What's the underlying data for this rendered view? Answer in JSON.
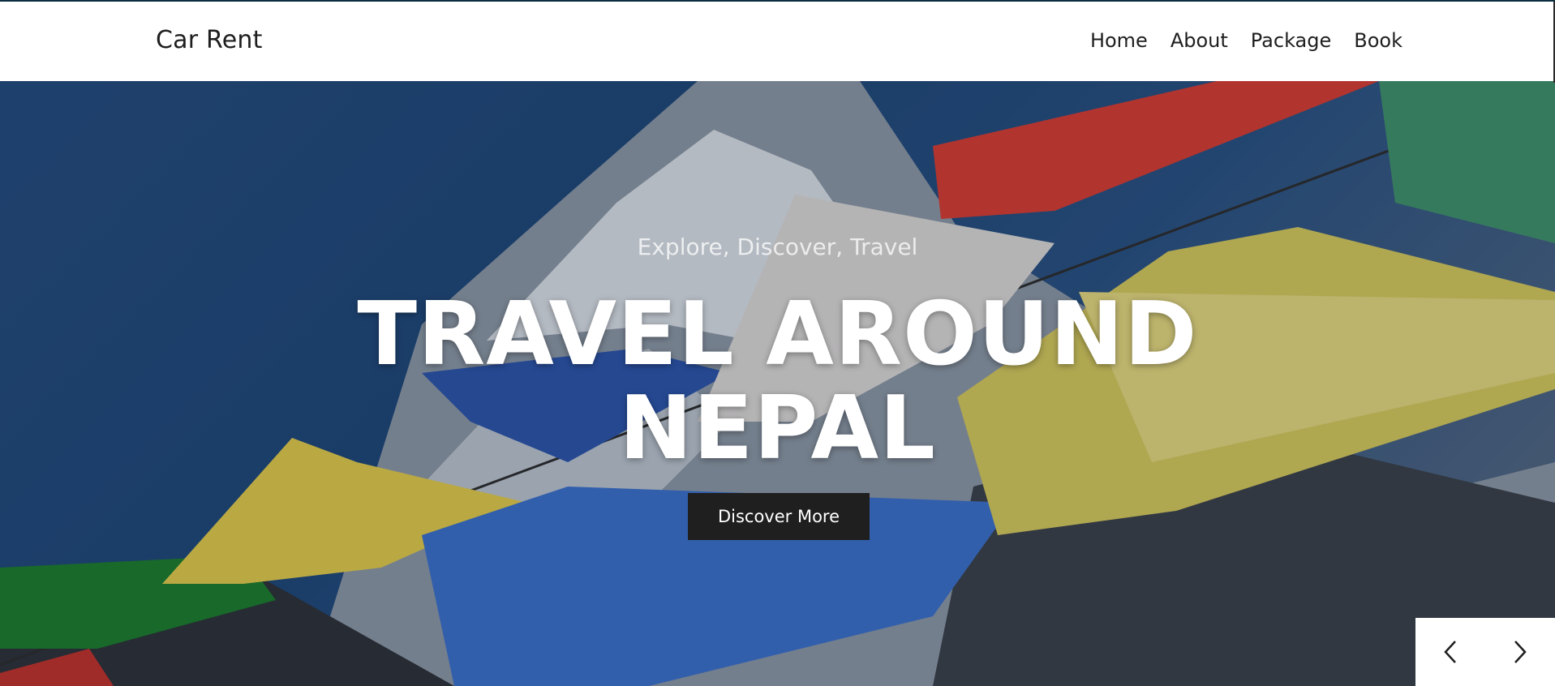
{
  "nav": {
    "brand": "Car Rent",
    "links": [
      "Home",
      "About",
      "Package",
      "Book"
    ]
  },
  "hero": {
    "subtitle": "Explore, Discover, Travel",
    "title_line1": "TRAVEL AROUND",
    "title_line2": "NEPAL",
    "cta_label": "Discover More"
  },
  "icons": {
    "prev": "chevron-left-icon",
    "next": "chevron-right-icon"
  },
  "colors": {
    "nav_bg": "#ffffff",
    "text_dark": "#1e1e1e",
    "cta_bg": "#1f1f1f",
    "hero_sky": "#22497a"
  }
}
